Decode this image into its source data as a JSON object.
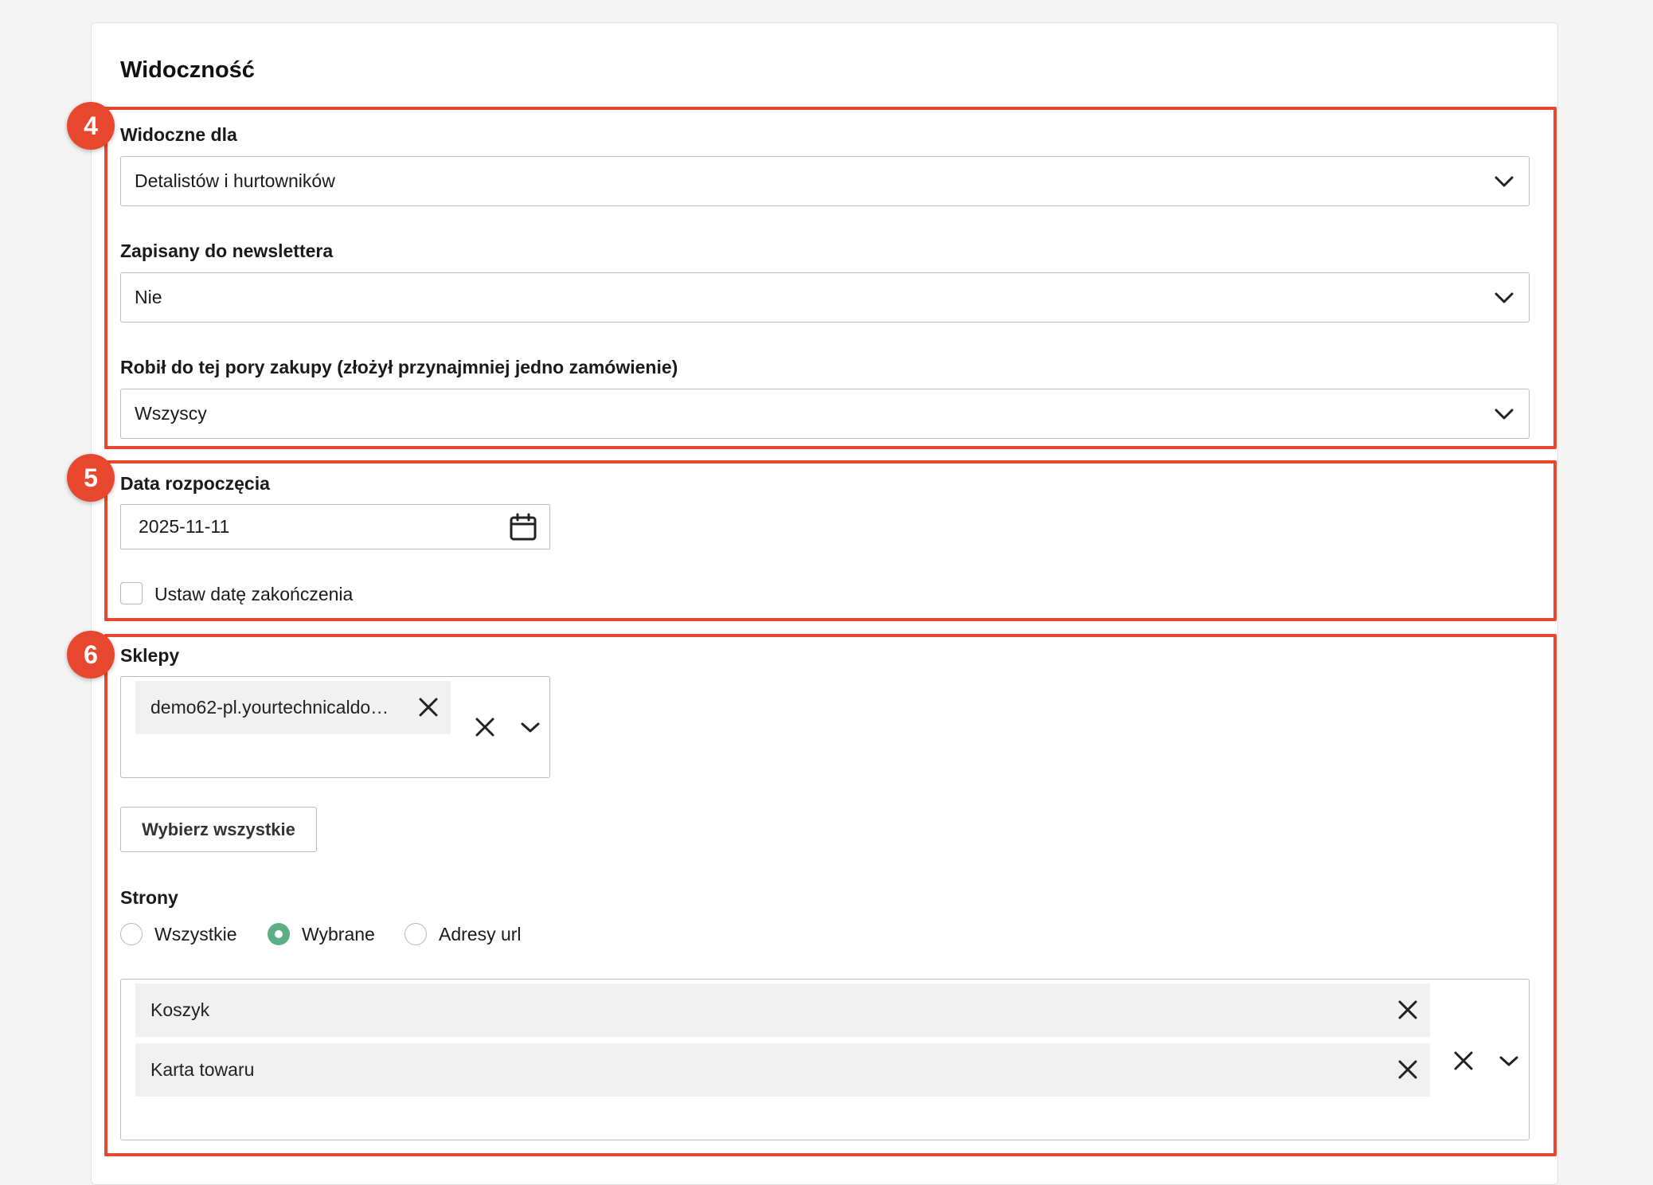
{
  "section": {
    "title": "Widoczność"
  },
  "annotations": [
    "4",
    "5",
    "6"
  ],
  "visibility": {
    "visible_for": {
      "label": "Widoczne dla",
      "value": "Detalistów i hurtowników"
    },
    "newsletter": {
      "label": "Zapisany do newslettera",
      "value": "Nie"
    },
    "purchased": {
      "label": "Robił do tej pory zakupy (złożył przynajmniej jedno zamówienie)",
      "value": "Wszyscy"
    }
  },
  "dates": {
    "start_label": "Data rozpoczęcia",
    "start_value": "2025-11-11",
    "end_checkbox_label": "Ustaw datę zakończenia",
    "end_checkbox_checked": false
  },
  "shops": {
    "label": "Sklepy",
    "selected": [
      "demo62-pl.yourtechnicaldo…"
    ],
    "select_all_label": "Wybierz wszystkie"
  },
  "pages": {
    "label": "Strony",
    "options": [
      "Wszystkie",
      "Wybrane",
      "Adresy url"
    ],
    "selected_option": "Wybrane",
    "selected": [
      "Koszyk",
      "Karta towaru"
    ]
  },
  "colors": {
    "highlight": "#e8472f",
    "radio_checked": "#5cae86"
  }
}
